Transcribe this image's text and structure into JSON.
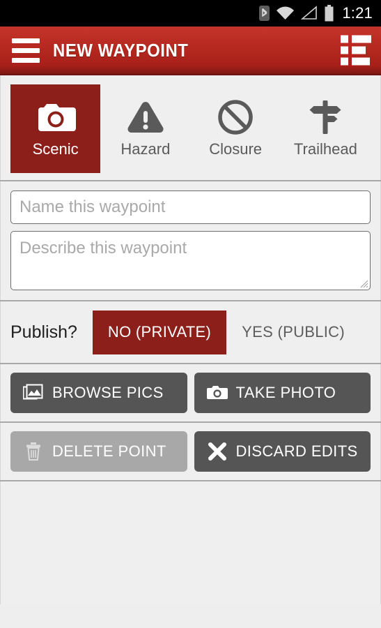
{
  "statusbar": {
    "time": "1:21",
    "icons": [
      "bluetooth-icon",
      "wifi-icon",
      "cell-signal-icon",
      "battery-icon"
    ]
  },
  "actionbar": {
    "title": "NEW WAYPOINT",
    "menu_icon": "hamburger-menu-icon",
    "list_icon": "list-view-icon",
    "bg_color": "#b4281f"
  },
  "categories": {
    "selected": "Scenic",
    "selected_color": "#8c1f1a",
    "items": [
      {
        "label": "Scenic",
        "icon": "camera-icon",
        "selected": true
      },
      {
        "label": "Hazard",
        "icon": "warning-triangle-icon",
        "selected": false
      },
      {
        "label": "Closure",
        "icon": "no-entry-icon",
        "selected": false
      },
      {
        "label": "Trailhead",
        "icon": "signpost-icon",
        "selected": false
      }
    ]
  },
  "form": {
    "name_value": "",
    "name_placeholder": "Name this waypoint",
    "description_value": "",
    "description_placeholder": "Describe this waypoint"
  },
  "publish": {
    "label": "Publish?",
    "selected": "NO (PRIVATE)",
    "options": [
      {
        "label": "NO (PRIVATE)",
        "selected": true
      },
      {
        "label": "YES (PUBLIC)",
        "selected": false
      }
    ]
  },
  "actions": {
    "browse_pics": {
      "label": "BROWSE PICS",
      "icon": "photos-stack-icon",
      "enabled": true
    },
    "take_photo": {
      "label": "TAKE PHOTO",
      "icon": "camera-icon",
      "enabled": true
    },
    "delete_point": {
      "label": "DELETE POINT",
      "icon": "trash-icon",
      "enabled": false
    },
    "discard_edits": {
      "label": "DISCARD EDITS",
      "icon": "close-x-icon",
      "enabled": true
    }
  }
}
